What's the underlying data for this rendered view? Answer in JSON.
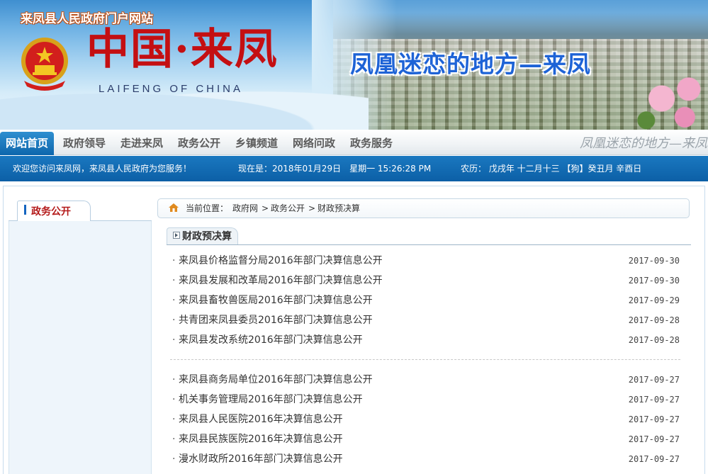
{
  "header": {
    "site_title": "来凤县人民政府门户网站",
    "brand_cn": "中国·来凤",
    "brand_en": "LAIFENG OF CHINA",
    "slogan": "凤凰迷恋的地方—来凤"
  },
  "nav": {
    "items": [
      "网站首页",
      "政府领导",
      "走进来凤",
      "政务公开",
      "乡镇频道",
      "网络问政",
      "政务服务"
    ],
    "active": "网站首页",
    "slogan": "凤凰迷恋的地方—来凤"
  },
  "infobar": {
    "welcome": "欢迎您访问来凤网，来凤县人民政府为您服务！",
    "now": "现在是：2018年01月29日　星期一 15:26:28 PM",
    "lunar": "农历： 戊戌年 十二月十三 【狗】癸丑月 辛酉日"
  },
  "sidebar": {
    "tab_label": "政务公开"
  },
  "breadcrumb": {
    "label": "当前位置：",
    "items": [
      "政府网",
      "政务公开",
      "财政预决算"
    ],
    "sep": ">"
  },
  "section": {
    "title": "财政预决算"
  },
  "list": {
    "items": [
      {
        "title": "来凤县价格监督分局2016年部门决算信息公开",
        "date": "2017-09-30"
      },
      {
        "title": "来凤县发展和改革局2016年部门决算信息公开",
        "date": "2017-09-30"
      },
      {
        "title": "来凤县畜牧兽医局2016年部门决算信息公开",
        "date": "2017-09-29"
      },
      {
        "title": "共青团来凤县委员2016年部门决算信息公开",
        "date": "2017-09-28"
      },
      {
        "title": "来凤县发改系统2016年部门决算信息公开",
        "date": "2017-09-28"
      },
      {
        "title": "来凤县商务局单位2016年部门决算信息公开",
        "date": "2017-09-27"
      },
      {
        "title": "机关事务管理局2016年部门决算信息公开",
        "date": "2017-09-27"
      },
      {
        "title": "来凤县人民医院2016年决算信息公开",
        "date": "2017-09-27"
      },
      {
        "title": "来凤县民族医院2016年决算信息公开",
        "date": "2017-09-27"
      },
      {
        "title": "漫水财政所2016年部门决算信息公开",
        "date": "2017-09-27"
      }
    ]
  },
  "colors": {
    "nav_active": "#0d66ac",
    "infobar": "#0c5fa6",
    "brand_red": "#c40f12",
    "slogan_blue": "#1e63d6",
    "sidebar_label": "#b41a1a"
  }
}
